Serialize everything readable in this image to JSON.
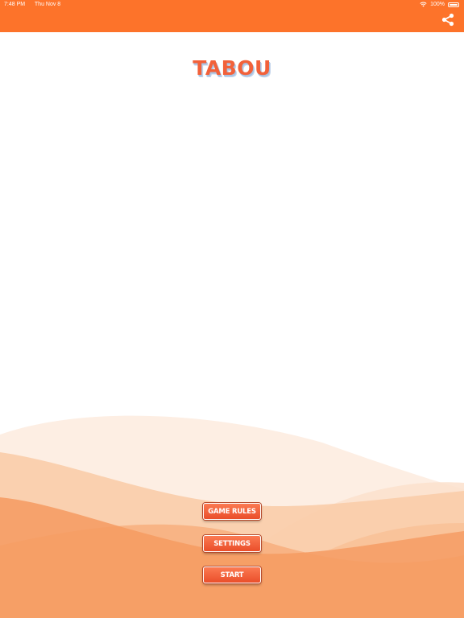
{
  "status_bar": {
    "time": "7:48 PM",
    "date": "Thu Nov 8",
    "battery": "100%"
  },
  "app": {
    "title": "TABOU"
  },
  "menu": {
    "game_rules": "GAME RULES",
    "settings": "SETTINGS",
    "start": "START"
  },
  "icons": {
    "share": "share-icon",
    "wifi": "wifi-icon",
    "battery": "battery-icon"
  },
  "colors": {
    "header": "#fd732a",
    "title": "#f2613a",
    "button": "#ea4e2a",
    "wave_light": "#fde9dc",
    "wave_mid": "#f9c8a4",
    "wave_dark": "#f6a06a"
  }
}
